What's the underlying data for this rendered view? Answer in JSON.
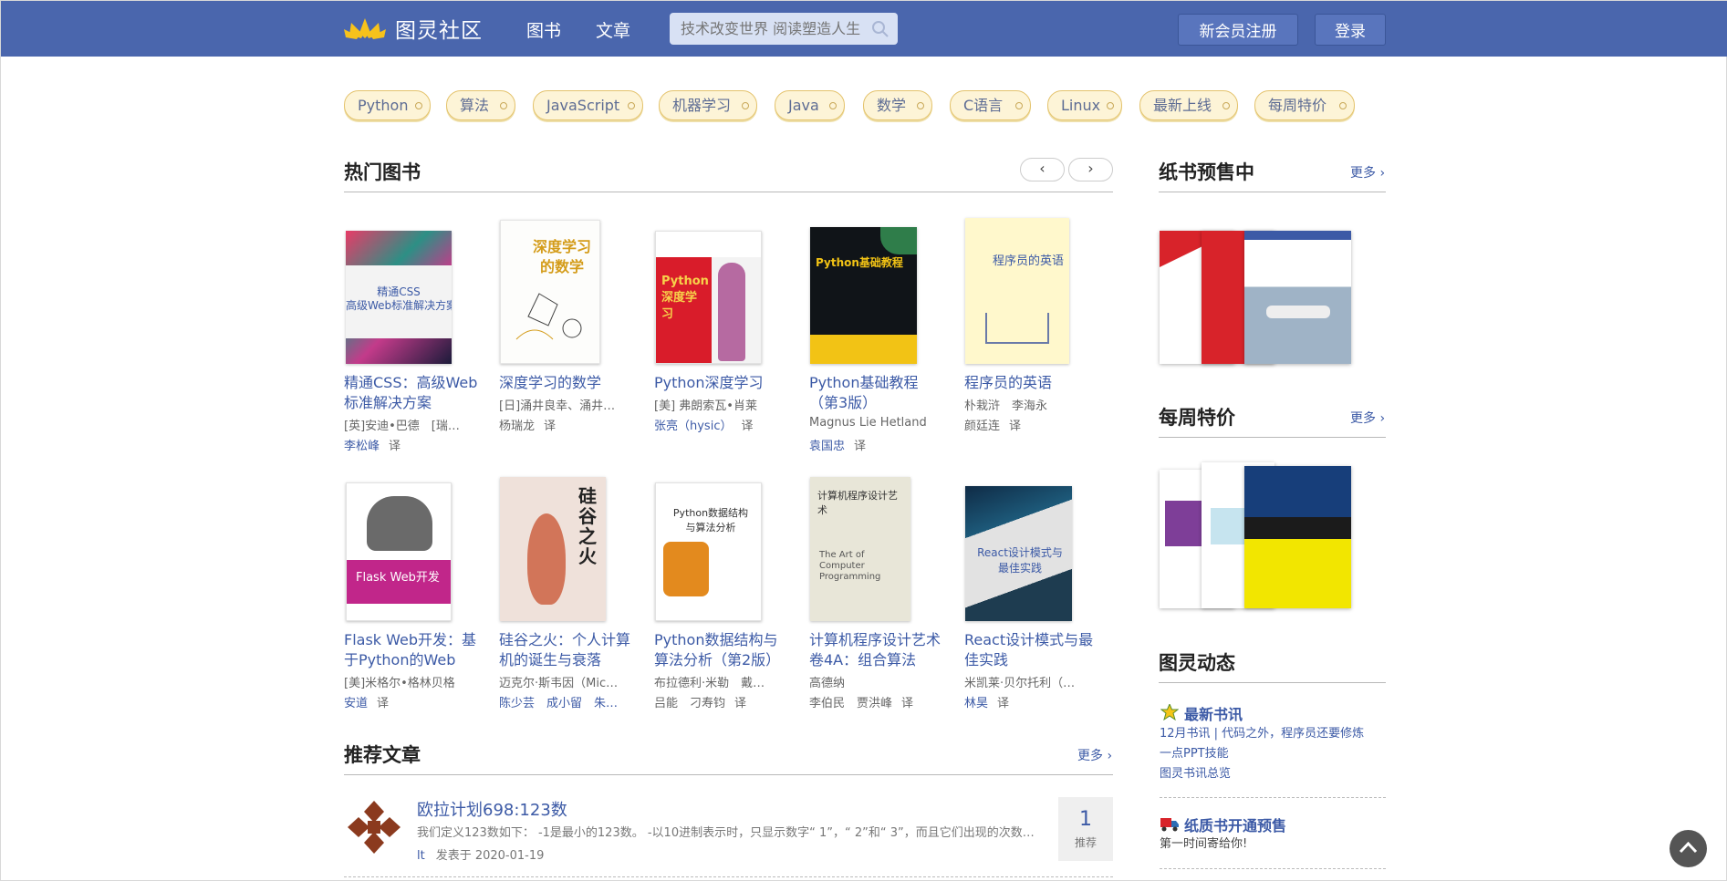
{
  "header": {
    "logo_text": "图灵社区",
    "nav": [
      "图书",
      "文章"
    ],
    "search_placeholder": "技术改变世界 阅读塑造人生",
    "register_label": "新会员注册",
    "login_label": "登录",
    "bar_color": "#4a66ad"
  },
  "tags": [
    "Python",
    "算法",
    "JavaScript",
    "机器学习",
    "Java",
    "数学",
    "C语言",
    "Linux",
    "最新上线",
    "每周特价"
  ],
  "hot_books": {
    "title": "热门图书",
    "prev": "‹",
    "next": "›",
    "items": [
      {
        "title": "精通CSS：高级Web标准解决方案",
        "author": "[英]安迪•巴德　[瑞…",
        "translator": "李松峰",
        "yi": "译",
        "cover_text": "精通CSS\n高级Web标准解决方案"
      },
      {
        "title": "深度学习的数学",
        "author": "[日]涌井良幸、涌井…",
        "translator": "杨瑞龙",
        "yi": "译",
        "cover_text": "深度学习的数学"
      },
      {
        "title": "Python深度学习",
        "author": "[美] 弗朗索瓦•肖莱",
        "translator": "张亮（hysic）",
        "yi": "译",
        "cover_text": "Python深度学习"
      },
      {
        "title": "Python基础教程（第3版）",
        "author": "Magnus Lie Hetland",
        "translator": "袁国忠",
        "yi": "译",
        "cover_text": "Python基础教程"
      },
      {
        "title": "程序员的英语",
        "author": "朴栽浒　李海永",
        "translator": "颜廷连",
        "yi": "译",
        "cover_text": "程序员的英语"
      },
      {
        "title": "Flask Web开发：基于Python的Web",
        "author": "[美]米格尔•格林贝格",
        "translator": "安道",
        "yi": "译",
        "cover_text": "Flask Web开发"
      },
      {
        "title": "硅谷之火：个人计算机的诞生与衰落",
        "author": "迈克尔·斯韦因（Mic…",
        "translator": "陈少芸　成小留　朱…",
        "yi": "",
        "cover_text": "硅谷之火"
      },
      {
        "title": "Python数据结构与算法分析（第2版）",
        "author": "布拉德利·米勒　戴…",
        "translator": "吕能　刁寿钧",
        "yi": "译",
        "cover_text": "Python数据结构与算法分析"
      },
      {
        "title": "计算机程序设计艺术 卷4A：组合算法",
        "author": "高德纳",
        "translator": "李伯民　贾洪峰",
        "yi": "译",
        "cover_text": "计算机程序设计艺术"
      },
      {
        "title": "React设计模式与最佳实践",
        "author": "米凯莱·贝尔托利（…",
        "translator": "林昊",
        "yi": "译",
        "cover_text": "React设计模式与最佳实践"
      }
    ]
  },
  "articles": {
    "title": "推荐文章",
    "more": "更多 ›",
    "item": {
      "title": "欧拉计划698:123数",
      "summary": "我们定义123数如下：  -1是最小的123数。 -以10进制表示时，只显示数字“ 1”，“ 2”和“ 3”，而且它们出现的次数…",
      "author": "lt",
      "date": "发表于 2020-01-19",
      "rec_count": "1",
      "rec_label": "推荐"
    }
  },
  "sidebar": {
    "presale": {
      "title": "纸书预售中",
      "more": "更多 ›"
    },
    "weekly": {
      "title": "每周特价",
      "more": "更多 ›"
    },
    "news": {
      "title": "图灵动态",
      "items": [
        {
          "title": "最新书讯",
          "lines": [
            "12月书讯 | 代码之外，程序员还要修炼",
            "一点PPT技能",
            "图灵书讯总览"
          ]
        },
        {
          "title": "纸质书开通预售",
          "lines": [
            "第一时间寄给你!"
          ]
        }
      ]
    }
  }
}
